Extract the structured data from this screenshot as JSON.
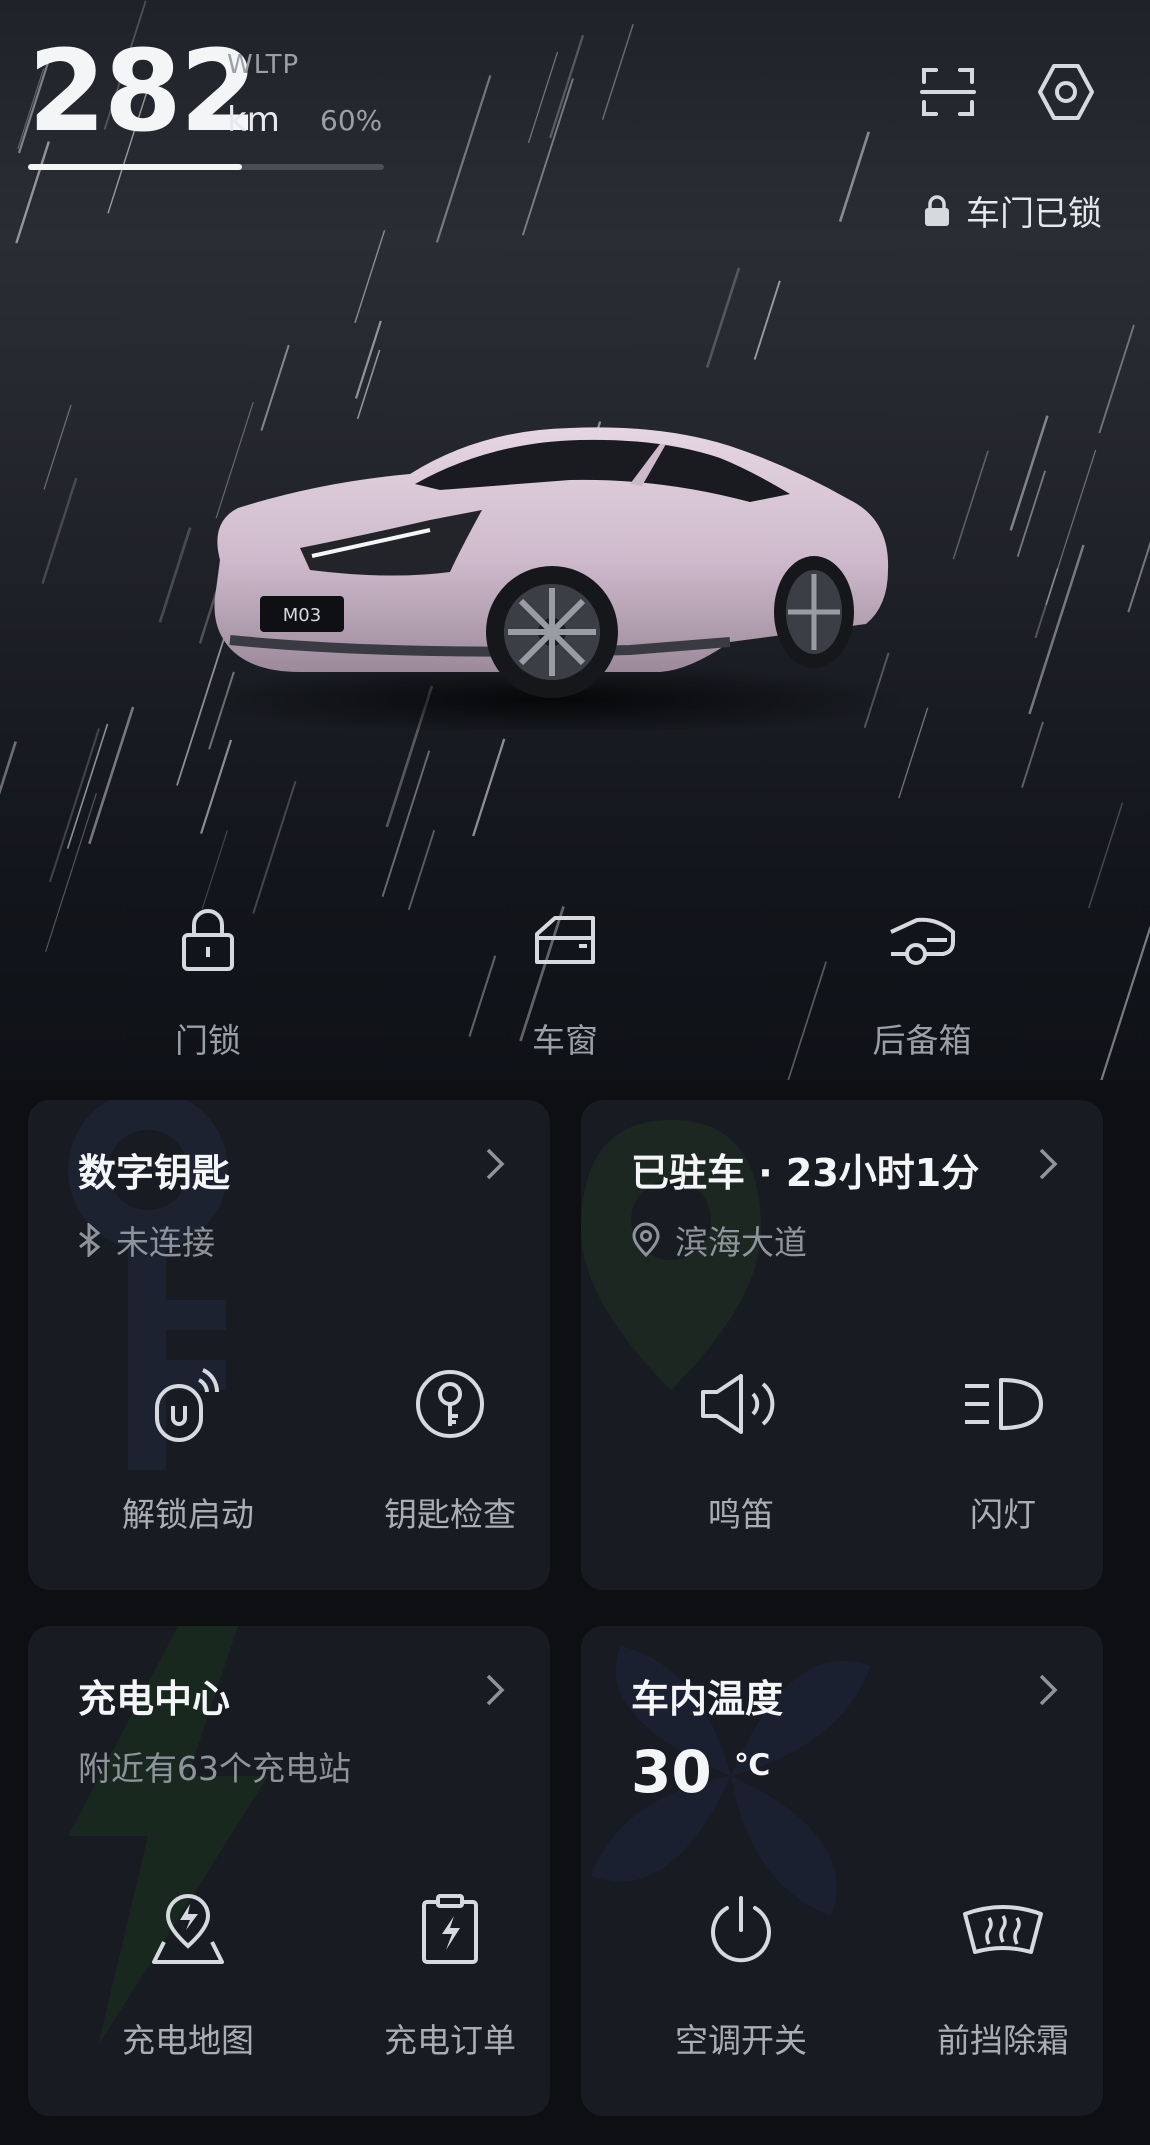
{
  "range": {
    "value": "282",
    "standard": "WLTP",
    "unit": "km",
    "battery": "60%",
    "battery_fraction": 0.6
  },
  "header": {
    "scan_icon": "scan-icon",
    "settings_icon": "settings-icon",
    "lock_status": "车门已锁"
  },
  "car": {
    "plate": "M03",
    "color": "#d8c6d6"
  },
  "quick_actions": [
    {
      "label": "门锁",
      "icon": "padlock-icon"
    },
    {
      "label": "车窗",
      "icon": "window-icon"
    },
    {
      "label": "后备箱",
      "icon": "trunk-icon"
    }
  ],
  "cards": {
    "digital_key": {
      "title": "数字钥匙",
      "status": "未连接",
      "actions": [
        {
          "label": "解锁启动",
          "icon": "unlock-start-icon"
        },
        {
          "label": "钥匙检查",
          "icon": "key-check-icon"
        }
      ]
    },
    "parking": {
      "title": "已驻车 · 23小时1分",
      "location": "滨海大道",
      "actions": [
        {
          "label": "鸣笛",
          "icon": "horn-icon"
        },
        {
          "label": "闪灯",
          "icon": "headlight-icon"
        }
      ]
    },
    "charging": {
      "title": "充电中心",
      "subtitle": "附近有63个充电站",
      "actions": [
        {
          "label": "充电地图",
          "icon": "charge-map-icon"
        },
        {
          "label": "充电订单",
          "icon": "charge-order-icon"
        }
      ]
    },
    "climate": {
      "title": "车内温度",
      "temperature": "30",
      "temperature_unit": "℃",
      "actions": [
        {
          "label": "空调开关",
          "icon": "power-icon"
        },
        {
          "label": "前挡除霜",
          "icon": "defrost-icon"
        }
      ]
    }
  },
  "colors": {
    "background": "#0d0f13",
    "card": "#181b21",
    "text_primary": "#f4f5f7",
    "text_secondary": "#9aa0a8"
  }
}
